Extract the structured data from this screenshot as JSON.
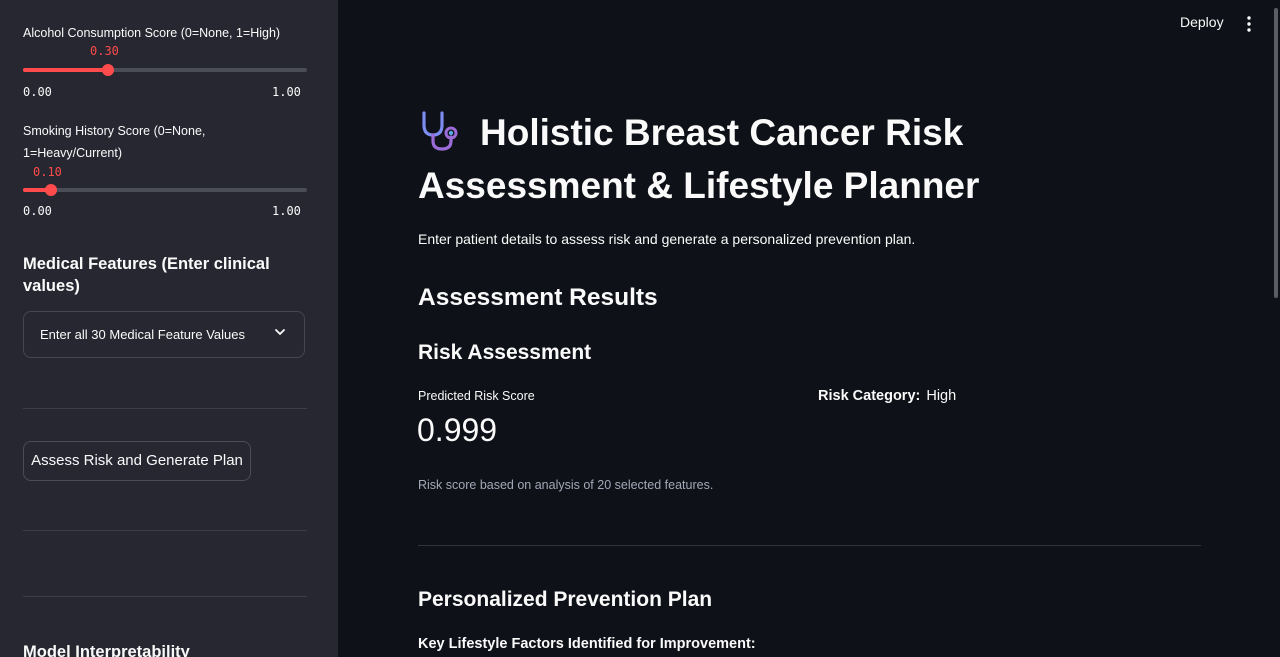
{
  "sidebar": {
    "alcohol_slider": {
      "label": "Alcohol Consumption Score (0=None, 1=High)",
      "value": "0.30",
      "min": "0.00",
      "max": "1.00",
      "fraction": 0.3
    },
    "smoking_slider": {
      "label": "Smoking History Score (0=None, 1=Heavy/Current)",
      "value": "0.10",
      "min": "0.00",
      "max": "1.00",
      "fraction": 0.1
    },
    "medical_header": "Medical Features (Enter clinical values)",
    "medical_expander_label": "Enter all 30 Medical Feature Values",
    "assess_button": "Assess Risk and Generate Plan",
    "interpretability_header": "Model Interpretability"
  },
  "header": {
    "deploy": "Deploy"
  },
  "main": {
    "title": "Holistic Breast Cancer Risk Assessment & Lifestyle Planner",
    "subtitle": "Enter patient details to assess risk and generate a personalized prevention plan.",
    "results_header": "Assessment Results",
    "risk_header": "Risk Assessment",
    "metric_label": "Predicted Risk Score",
    "metric_value": "0.999",
    "risk_category_label": "Risk Category:",
    "risk_category_value": "High",
    "caption": "Risk score based on analysis of 20 selected features.",
    "plan_header": "Personalized Prevention Plan",
    "key_factors": "Key Lifestyle Factors Identified for Improvement:"
  },
  "colors": {
    "accent": "#ff4b4b",
    "sidebar_bg": "#262730",
    "main_bg": "#0e1117"
  }
}
